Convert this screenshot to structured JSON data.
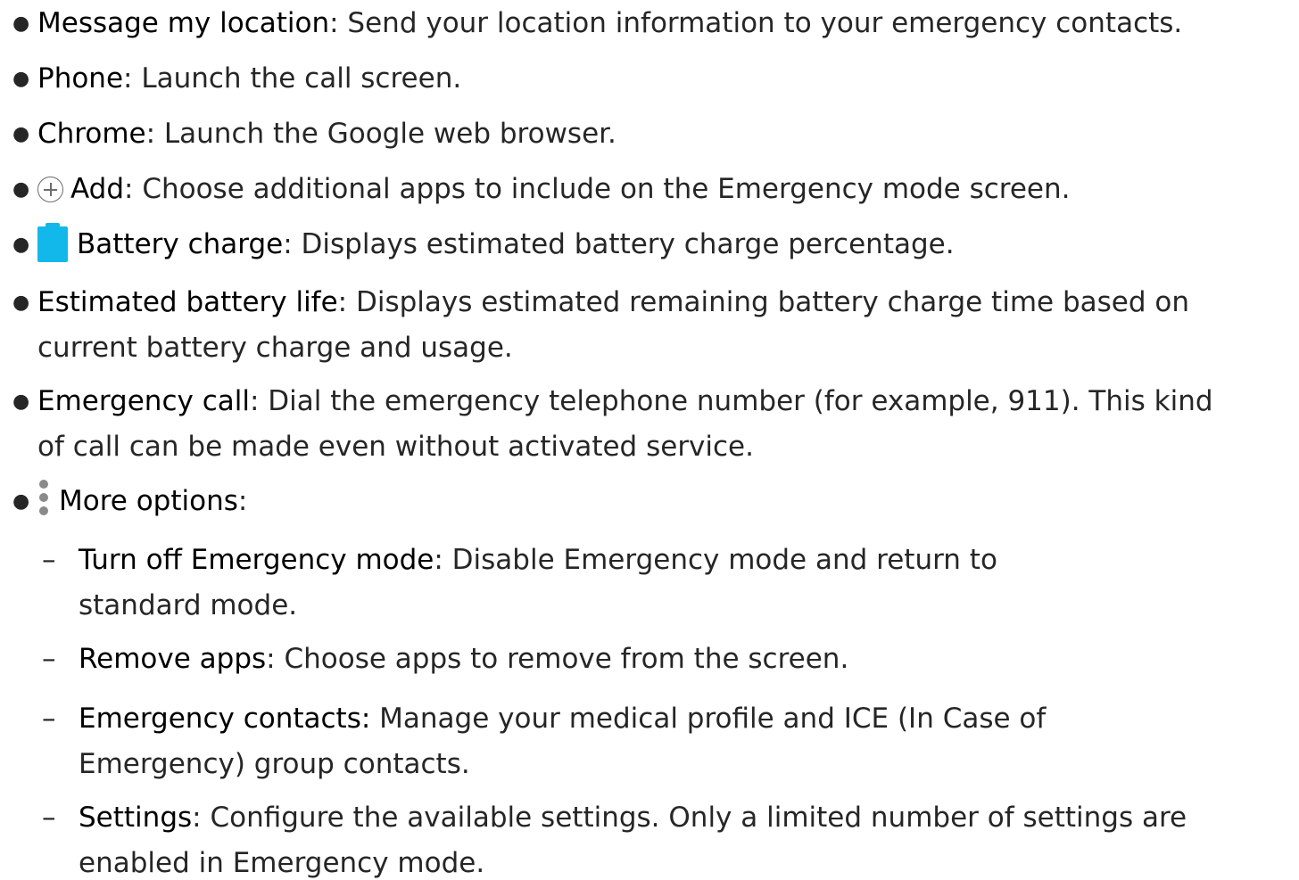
{
  "bullets": [
    {
      "term": "Message my location",
      "desc": ": Send your location information to your emergency contacts."
    },
    {
      "term": "Phone",
      "desc": ": Launch the call screen."
    },
    {
      "term": "Chrome",
      "desc": ": Launch the Google web browser."
    },
    {
      "icon": "plus-circle-icon",
      "term": "Add",
      "desc": ": Choose additional apps to include on the Emergency mode screen."
    },
    {
      "icon": "battery-icon",
      "term": "Battery charge",
      "desc": ": Displays estimated battery charge percentage."
    },
    {
      "term": "Estimated battery life",
      "desc_line1": ": Displays estimated remaining battery charge time based on",
      "desc_line2": "current battery charge and usage."
    },
    {
      "term": "Emergency call",
      "desc_line1": ": Dial the emergency telephone number (for example, 911). This kind",
      "desc_line2": "of call can be made even without activated service."
    },
    {
      "icon": "more-options-icon",
      "term": "More options",
      "desc": ":"
    }
  ],
  "sub_items": [
    {
      "term": "Turn off Emergency mode",
      "desc_line1": ": Disable Emergency mode and return to",
      "desc_line2": "standard mode."
    },
    {
      "term": "Remove apps",
      "desc": ": Choose apps to remove from the screen."
    },
    {
      "term": "Emergency contacts:",
      "desc_line1": " Manage your medical profile and ICE (In Case of",
      "desc_line2": "Emergency) group contacts."
    },
    {
      "term": "Settings",
      "desc_line1": ": Configure the available settings. Only a limited number of settings are",
      "desc_line2": "enabled in Emergency mode."
    }
  ],
  "colors": {
    "text": "#262626",
    "battery": "#12b8ea",
    "icon_gray": "#8a8a8a"
  }
}
